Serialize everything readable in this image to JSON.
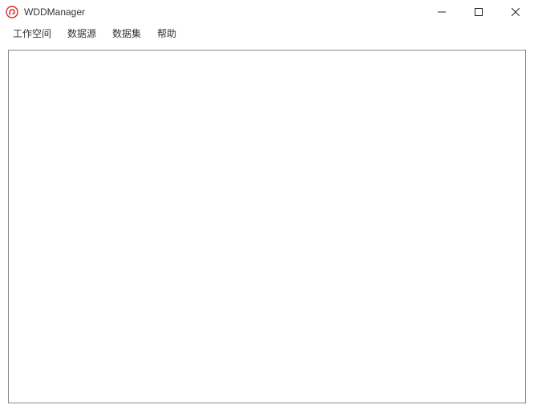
{
  "window": {
    "title": "WDDManager"
  },
  "menu": {
    "items": [
      "工作空间",
      "数据源",
      "数据集",
      "帮助"
    ]
  }
}
